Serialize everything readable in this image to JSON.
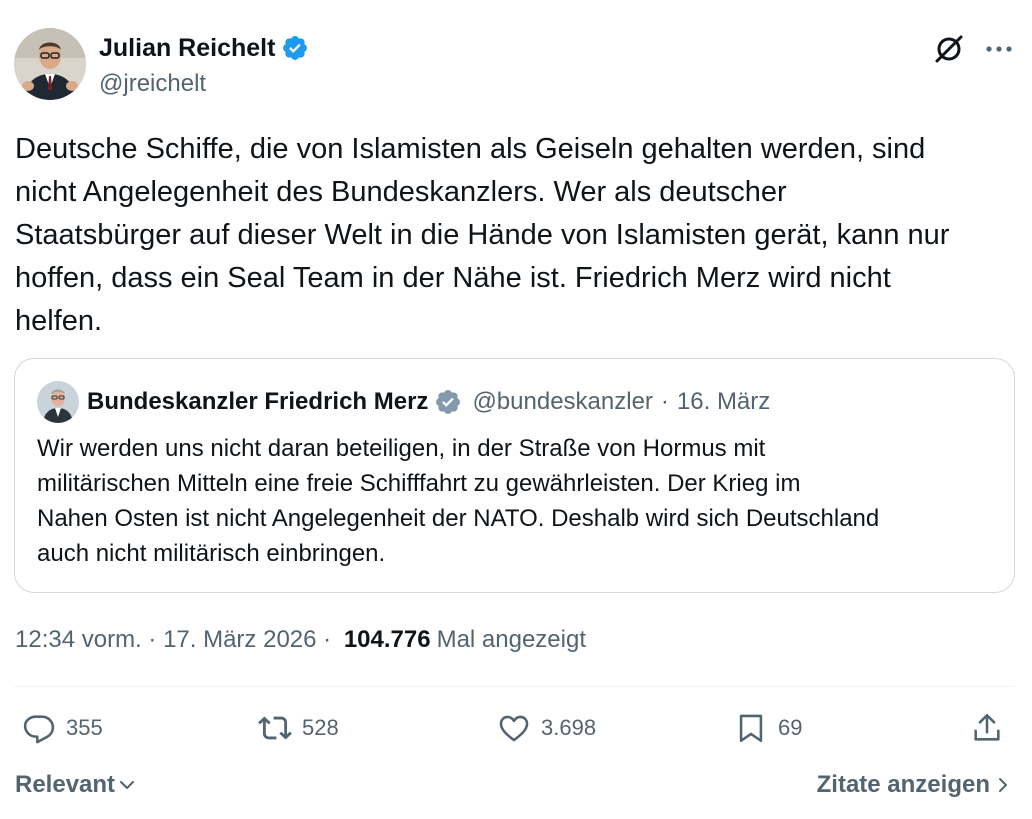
{
  "author": {
    "name": "Julian Reichelt",
    "handle": "@jreichelt",
    "verified_color": "#1d9bf0"
  },
  "icons": {
    "grok": "grok-icon",
    "more": "more-icon",
    "reply": "reply-icon",
    "retweet": "retweet-icon",
    "like": "heart-icon",
    "bookmark": "bookmark-icon",
    "share": "share-icon"
  },
  "tweet": {
    "text": "Deutsche Schiffe, die von Islamisten als Geiseln gehalten werden, sind\nnicht Angelegenheit des Bundeskanzlers. Wer als deutscher\nStaatsbürger auf dieser Welt in die Hände von Islamisten gerät, kann nur\nhoffen, dass ein Seal Team in der Nähe ist. Friedrich Merz wird nicht\nhelfen."
  },
  "quote": {
    "name": "Bundeskanzler Friedrich Merz",
    "handle": "@bundeskanzler",
    "separator": "·",
    "date": "16. März",
    "badge_color": "#829aab",
    "text": "Wir werden uns nicht daran beteiligen, in der Straße von Hormus mit\nmilitärischen Mitteln eine freie Schifffahrt zu gewährleisten. Der Krieg im\nNahen Osten ist nicht Angelegenheit der NATO. Deshalb wird sich Deutschland\nauch nicht militärisch einbringen."
  },
  "meta": {
    "time": "12:34 vorm.",
    "sep1": " · ",
    "date": "17. März 2026",
    "sep2": " · ",
    "views": "104.776",
    "views_label": "Mal angezeigt"
  },
  "actions": {
    "replies": "355",
    "reposts": "528",
    "likes": "3.698",
    "bookmarks": "69"
  },
  "footer": {
    "sort_label": "Relevant",
    "quotes_label": "Zitate anzeigen"
  }
}
